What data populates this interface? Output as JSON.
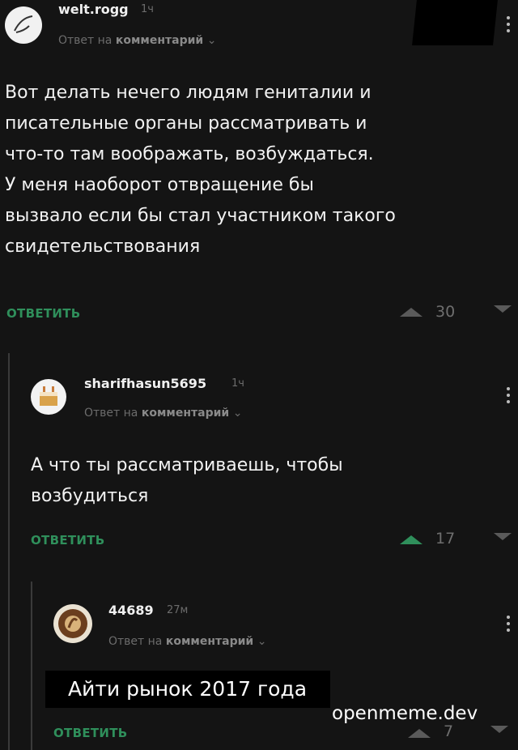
{
  "comments": [
    {
      "username": "welt.rogg",
      "time": "1ч",
      "reply_to_prefix": "Ответ на",
      "reply_to_label": "комментарий",
      "text_lines": [
        "Вот делать нечего людям гениталии и",
        "писательные органы рассматривать и",
        "что-то там воображать, возбуждаться.",
        "У меня наоборот отвращение бы",
        "вызвало если бы стал участником такого",
        "свидетельствования"
      ],
      "reply_label": "ОТВЕТИТЬ",
      "score": "30",
      "upvoted": false
    },
    {
      "username": "sharifhasun5695",
      "time": "1ч",
      "reply_to_prefix": "Ответ на",
      "reply_to_label": "комментарий",
      "text_lines": [
        "А что ты рассматриваешь, чтобы",
        "возбудиться"
      ],
      "reply_label": "ОТВЕТИТЬ",
      "score": "17",
      "upvoted": true
    },
    {
      "username": "44689",
      "time": "27м",
      "reply_to_prefix": "Ответ на",
      "reply_to_label": "комментарий",
      "text_lines": [],
      "reply_label": "ОТВЕТИТЬ",
      "score": "7",
      "upvoted": false
    }
  ],
  "caption": "Айти рынок 2017 года",
  "watermark": "openmeme.dev",
  "colors": {
    "background": "#141414",
    "reply_green": "#2f8f5b",
    "muted": "#6c6c6c"
  }
}
